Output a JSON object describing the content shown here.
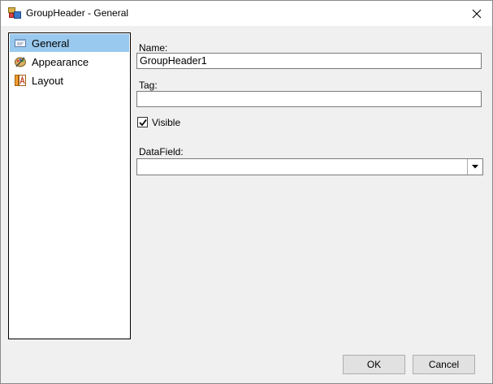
{
  "window": {
    "title": "GroupHeader - General"
  },
  "nav": {
    "items": [
      {
        "label": "General",
        "icon": "general-icon",
        "selected": true
      },
      {
        "label": "Appearance",
        "icon": "appearance-icon",
        "selected": false
      },
      {
        "label": "Layout",
        "icon": "layout-icon",
        "selected": false
      }
    ]
  },
  "form": {
    "name_label": "Name:",
    "name_value": "GroupHeader1",
    "tag_label": "Tag:",
    "tag_value": "",
    "visible_label": "Visible",
    "visible_checked": true,
    "datafield_label": "DataField:",
    "datafield_value": ""
  },
  "buttons": {
    "ok_label": "OK",
    "cancel_label": "Cancel"
  },
  "colors": {
    "selection": "#99c9ef",
    "dialog_bg": "#f0f0f0"
  }
}
